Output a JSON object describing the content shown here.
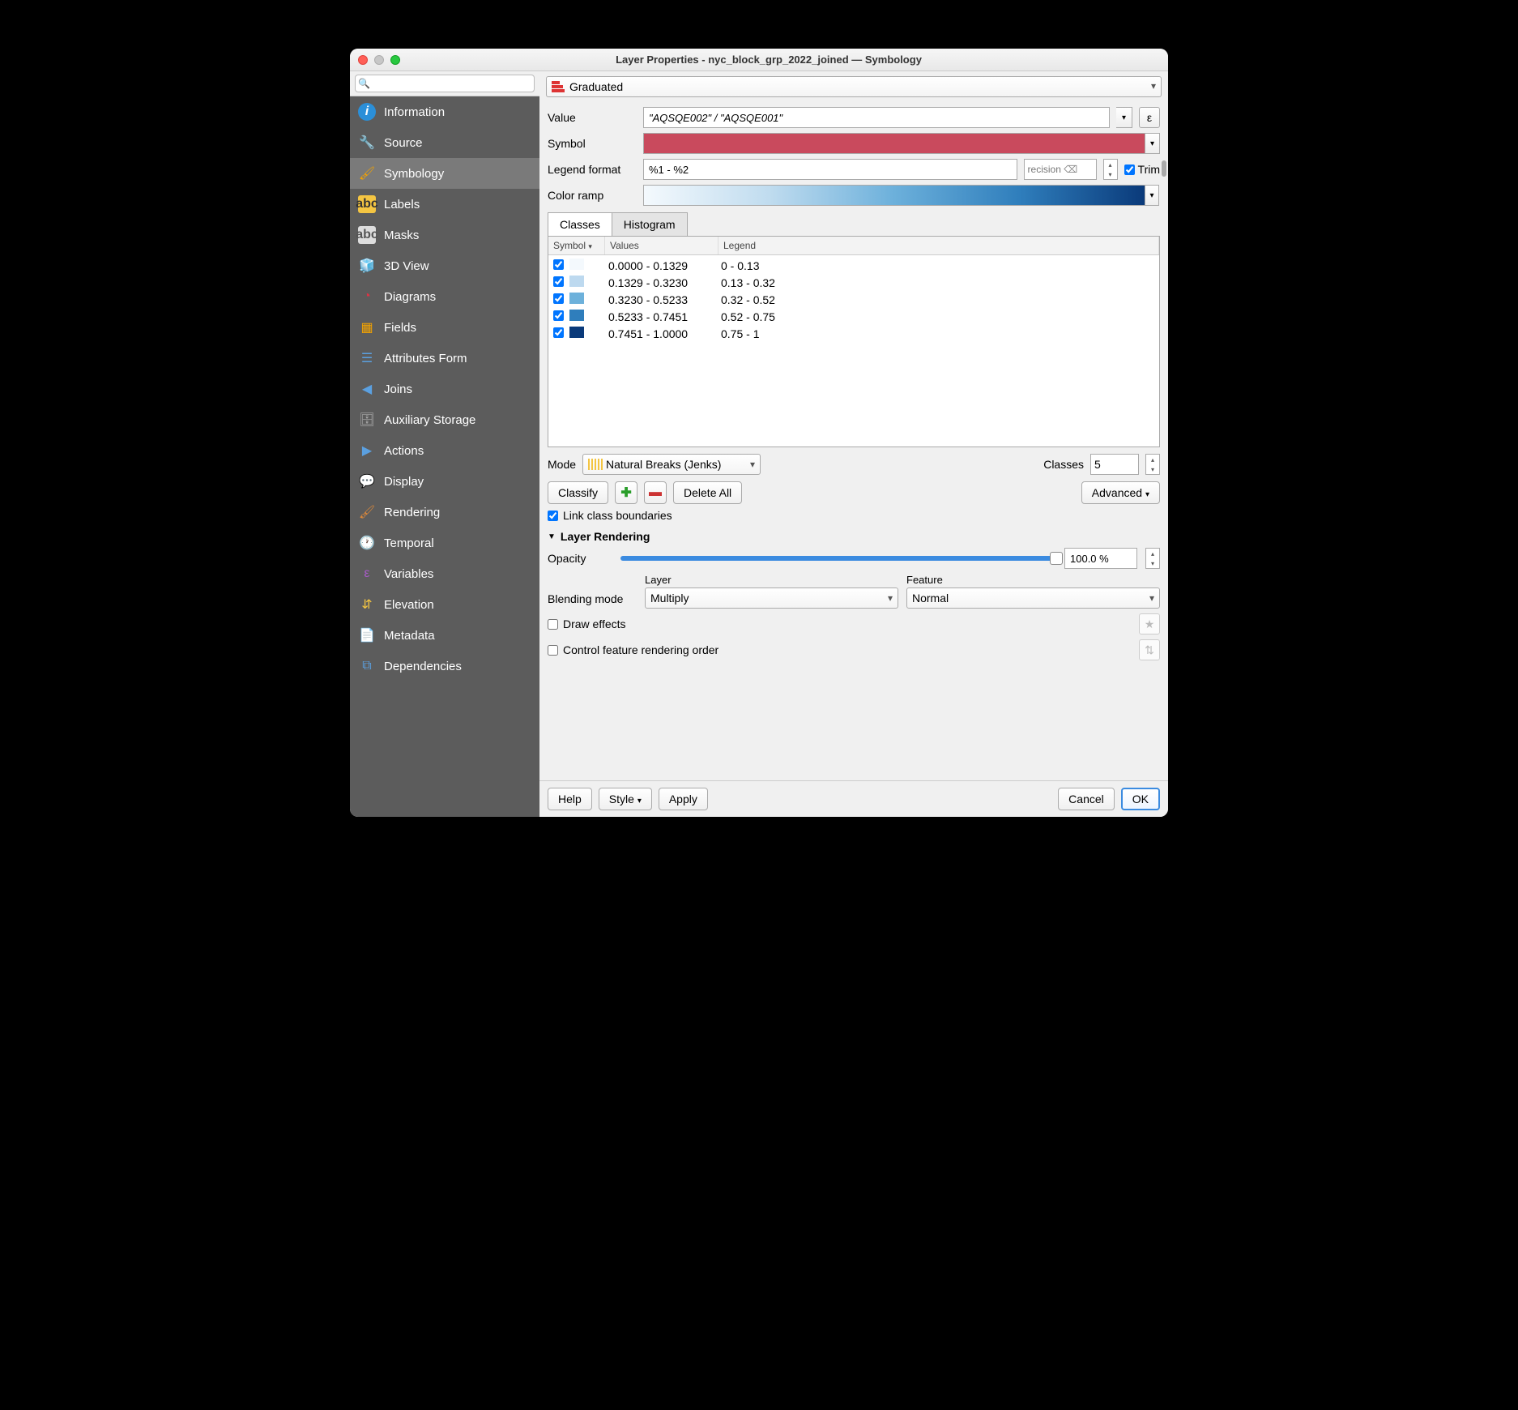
{
  "window": {
    "title": "Layer Properties - nyc_block_grp_2022_joined — Symbology"
  },
  "sidebar": {
    "search_placeholder": "",
    "items": [
      {
        "label": "Information"
      },
      {
        "label": "Source"
      },
      {
        "label": "Symbology"
      },
      {
        "label": "Labels"
      },
      {
        "label": "Masks"
      },
      {
        "label": "3D View"
      },
      {
        "label": "Diagrams"
      },
      {
        "label": "Fields"
      },
      {
        "label": "Attributes Form"
      },
      {
        "label": "Joins"
      },
      {
        "label": "Auxiliary Storage"
      },
      {
        "label": "Actions"
      },
      {
        "label": "Display"
      },
      {
        "label": "Rendering"
      },
      {
        "label": "Temporal"
      },
      {
        "label": "Variables"
      },
      {
        "label": "Elevation"
      },
      {
        "label": "Metadata"
      },
      {
        "label": "Dependencies"
      }
    ]
  },
  "renderer": {
    "type": "Graduated"
  },
  "value": {
    "label": "Value",
    "expression": "\"AQSQE002\" / \"AQSQE001\""
  },
  "symbol": {
    "label": "Symbol",
    "color": "#c94a5d"
  },
  "legend_format": {
    "label": "Legend format",
    "pattern": "%1 - %2",
    "precision_hint": "recision",
    "trim_label": "Trim",
    "trim_checked": true
  },
  "color_ramp": {
    "label": "Color ramp"
  },
  "tabs": {
    "classes": "Classes",
    "histogram": "Histogram"
  },
  "table": {
    "headers": {
      "symbol": "Symbol",
      "values": "Values",
      "legend": "Legend"
    },
    "rows": [
      {
        "checked": true,
        "color": "#f4f9fd",
        "values": "0.0000 - 0.1329",
        "legend": "0 - 0.13"
      },
      {
        "checked": true,
        "color": "#bdd9ef",
        "values": "0.1329 - 0.3230",
        "legend": "0.13 - 0.32"
      },
      {
        "checked": true,
        "color": "#6db1db",
        "values": "0.3230 - 0.5233",
        "legend": "0.32 - 0.52"
      },
      {
        "checked": true,
        "color": "#2f7ebc",
        "values": "0.5233 - 0.7451",
        "legend": "0.52 - 0.75"
      },
      {
        "checked": true,
        "color": "#0a3a7a",
        "values": "0.7451 - 1.0000",
        "legend": "0.75 - 1"
      }
    ]
  },
  "mode": {
    "label": "Mode",
    "value": "Natural Breaks (Jenks)",
    "classes_label": "Classes",
    "classes_value": "5"
  },
  "buttons": {
    "classify": "Classify",
    "delete_all": "Delete All",
    "advanced": "Advanced"
  },
  "link_boundaries": {
    "label": "Link class boundaries",
    "checked": true
  },
  "layer_rendering": {
    "heading": "Layer Rendering",
    "opacity_label": "Opacity",
    "opacity_value": "100.0 %",
    "blending_label": "Blending mode",
    "layer_label": "Layer",
    "layer_value": "Multiply",
    "feature_label": "Feature",
    "feature_value": "Normal",
    "draw_effects": "Draw effects",
    "control_order": "Control feature rendering order"
  },
  "footer": {
    "help": "Help",
    "style": "Style",
    "apply": "Apply",
    "cancel": "Cancel",
    "ok": "OK"
  }
}
